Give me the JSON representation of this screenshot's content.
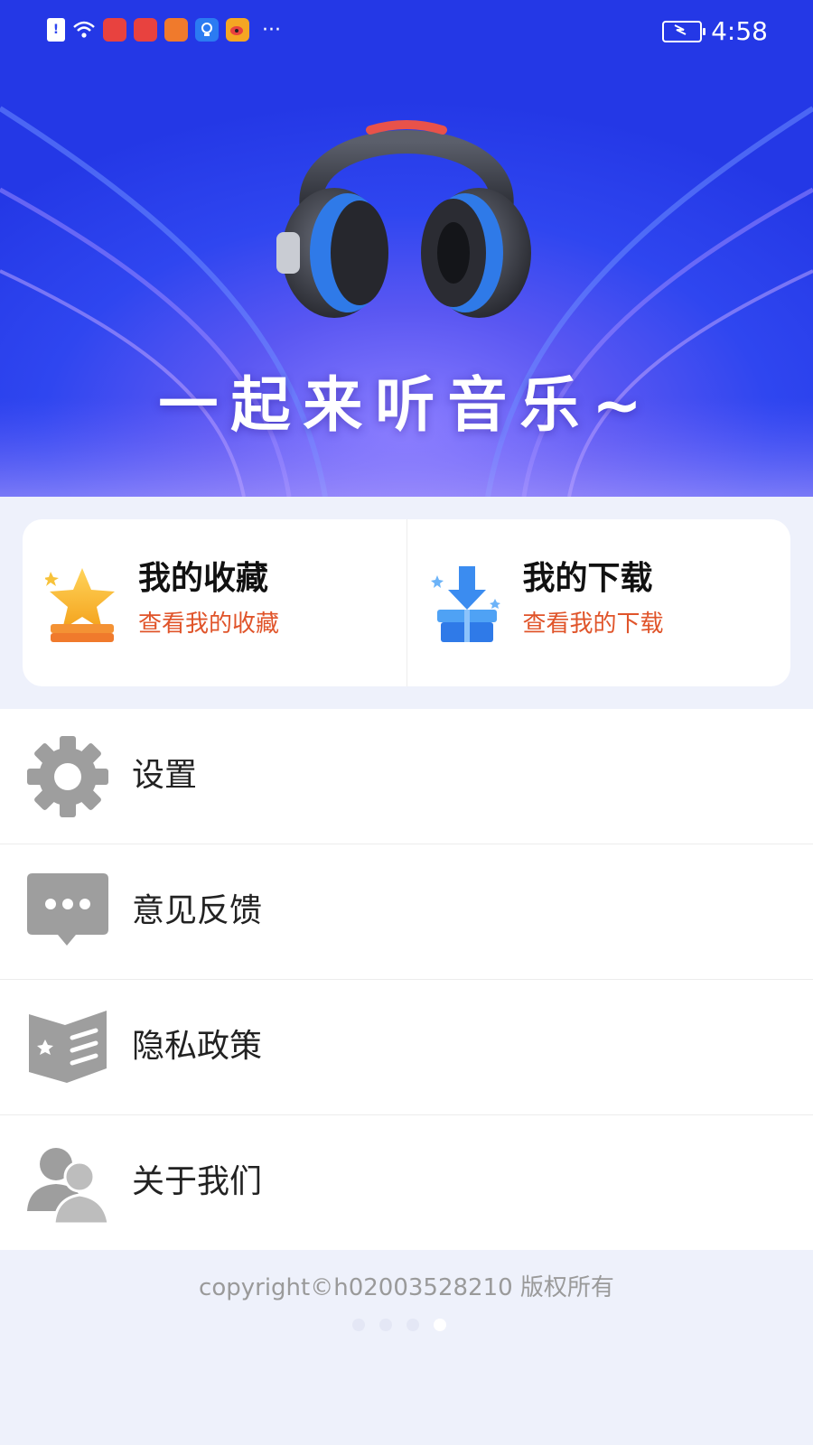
{
  "status_bar": {
    "time": "4:58",
    "more": "···"
  },
  "banner": {
    "title": "一起来听音乐~"
  },
  "quick_actions": [
    {
      "title": "我的收藏",
      "subtitle": "查看我的收藏",
      "icon": "star-icon"
    },
    {
      "title": "我的下载",
      "subtitle": "查看我的下载",
      "icon": "download-box-icon"
    }
  ],
  "menu": [
    {
      "label": "设置",
      "icon": "gear-icon"
    },
    {
      "label": "意见反馈",
      "icon": "chat-bubble-icon"
    },
    {
      "label": "隐私政策",
      "icon": "policy-book-icon"
    },
    {
      "label": "关于我们",
      "icon": "users-icon"
    }
  ],
  "footer": {
    "copyright": "copyright©h02003528210 版权所有"
  },
  "pager": {
    "count": 4,
    "active": 4
  },
  "colors": {
    "accent_text": "#e0542a",
    "banner_blue": "#2f46f0",
    "icon_gray": "#9e9e9e"
  }
}
